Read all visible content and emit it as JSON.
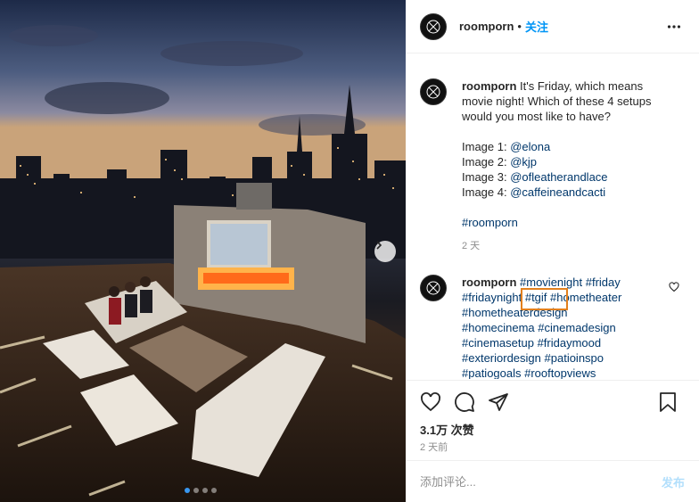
{
  "post": {
    "username": "roomporn",
    "follow_label": "关注",
    "separator": "•"
  },
  "caption": {
    "username": "roomporn",
    "lines": [
      "It's Friday, which means",
      "movie night! Which of these 4 setups",
      "would you most like to have?"
    ],
    "images": [
      {
        "label": "Image 1: ",
        "handle": "@elona"
      },
      {
        "label": "Image 2: ",
        "handle": "@kjp"
      },
      {
        "label": "Image 3: ",
        "handle": "@ofleatherandlace"
      },
      {
        "label": "Image 4: ",
        "handle": "@caffeineandcacti"
      }
    ],
    "hashtag": "#roomporn",
    "time": "2 天"
  },
  "comment": {
    "username": "roomporn",
    "tags": [
      "#movienight",
      "#friday",
      "#fridaynight",
      "#tgif",
      "#hometheater",
      "#hometheaterdesign",
      "#homecinema",
      "#cinemadesign",
      "#cinemasetup",
      "#fridaymood",
      "#exteriordesign",
      "#patioinspo",
      "#patiogoals",
      "#rooftopviews"
    ]
  },
  "actions": {
    "likes": "3.1万 次赞",
    "posted": "2 天前"
  },
  "comment_box": {
    "placeholder": "添加评论...",
    "post_label": "发布"
  },
  "carousel": {
    "count": 4,
    "active": 0
  }
}
